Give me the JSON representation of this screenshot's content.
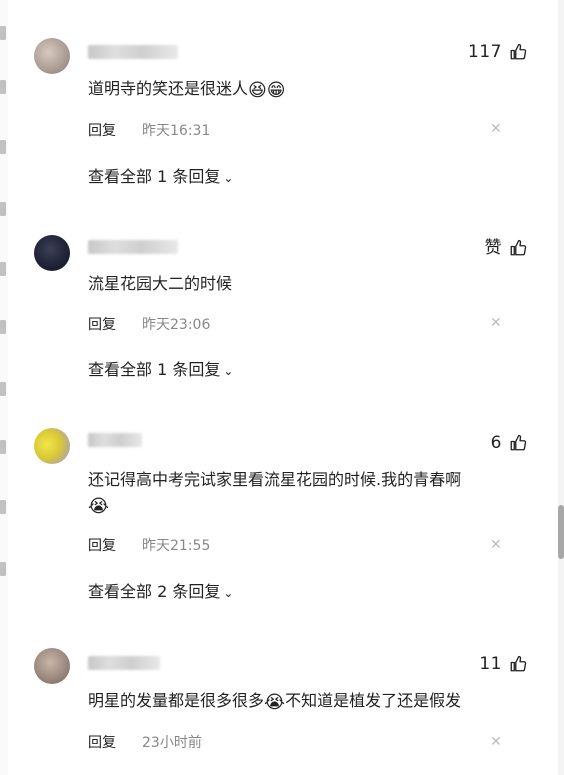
{
  "comments": [
    {
      "likes": "117",
      "text": "道明寺的笑还是很迷人",
      "emojis": [
        "😆",
        "😁"
      ],
      "reply_label": "回复",
      "time": "昨天16:31",
      "view_all": "查看全部 1 条回复"
    },
    {
      "likes": "赞",
      "text": "流星花园大二的时候",
      "emojis": [],
      "reply_label": "回复",
      "time": "昨天23:06",
      "view_all": "查看全部 1 条回复"
    },
    {
      "likes": "6",
      "text": "还记得高中考完试家里看流星花园的时候.我的青春啊",
      "emojis": [
        "😭"
      ],
      "reply_label": "回复",
      "time": "昨天21:55",
      "view_all": "查看全部 2 条回复"
    },
    {
      "likes": "11",
      "text": "明星的发量都是很多很多",
      "text_after": "不知道是植发了还是假发",
      "emojis": [
        "😭"
      ],
      "reply_label": "回复",
      "time": "23小时前",
      "view_all": ""
    }
  ],
  "icons": {
    "like": "thumbs-up-icon",
    "close": "close-icon",
    "chevron": "chevron-down-icon"
  },
  "colors": {
    "text": "#222222",
    "muted": "#888888",
    "close": "#bdbdbd"
  }
}
